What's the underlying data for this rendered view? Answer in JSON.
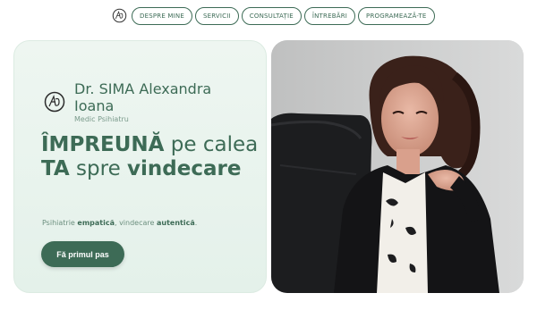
{
  "nav": {
    "links": [
      {
        "label": "DESPRE MINE"
      },
      {
        "label": "SERVICII"
      },
      {
        "label": "CONSULTAȚIE"
      },
      {
        "label": "ÎNTREBĂRI"
      },
      {
        "label": "PROGRAMEAZĂ-TE"
      }
    ],
    "logo_icon": "signature-monogram-icon"
  },
  "hero": {
    "doctor_name": "Dr. SIMA Alexandra Ioana",
    "doctor_title": "Medic Psihiatru",
    "headline_part1": "ÎMPREUNĂ",
    "headline_part2": " pe calea ",
    "headline_part3": "TA",
    "headline_part4": " spre ",
    "headline_part5": "vindecare",
    "tagline_part1": "Psihiatrie ",
    "tagline_part2": "empatică",
    "tagline_part3": ", vindecare ",
    "tagline_part4": "autentică",
    "tagline_part5": ".",
    "cta_label": "Fă primul pas"
  },
  "photo": {
    "icon": "doctor-portrait-photo"
  },
  "colors": {
    "brand": "#3d6b56",
    "card_bg": "#e8f3ed",
    "muted": "#7a9a8b"
  }
}
